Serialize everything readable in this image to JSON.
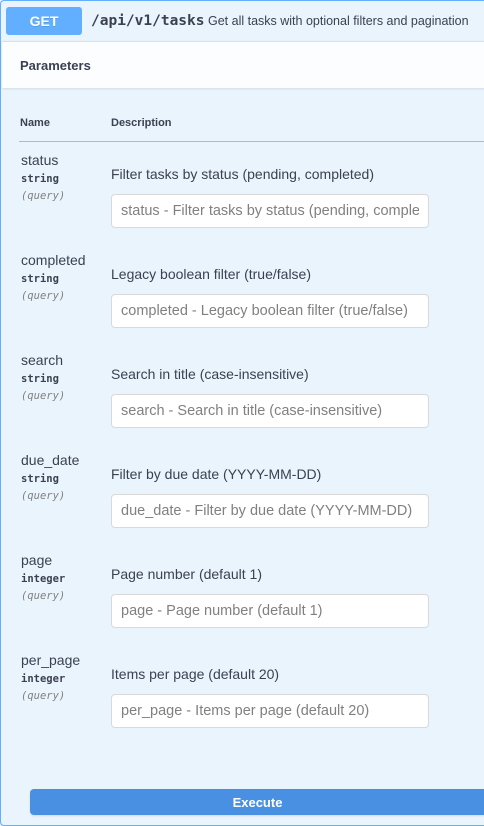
{
  "operation": {
    "method": "GET",
    "path": "/api/v1/tasks",
    "summary": "Get all tasks with optional filters and pagination"
  },
  "params_section": {
    "title": "Parameters",
    "col_name": "Name",
    "col_description": "Description"
  },
  "parameters": [
    {
      "name": "status",
      "type": "string",
      "in": "(query)",
      "description": "Filter tasks by status (pending, completed)",
      "placeholder": "status - Filter tasks by status (pending, completed)"
    },
    {
      "name": "completed",
      "type": "string",
      "in": "(query)",
      "description": "Legacy boolean filter (true/false)",
      "placeholder": "completed - Legacy boolean filter (true/false)"
    },
    {
      "name": "search",
      "type": "string",
      "in": "(query)",
      "description": "Search in title (case-insensitive)",
      "placeholder": "search - Search in title (case-insensitive)"
    },
    {
      "name": "due_date",
      "type": "string",
      "in": "(query)",
      "description": "Filter by due date (YYYY-MM-DD)",
      "placeholder": "due_date - Filter by due date (YYYY-MM-DD)"
    },
    {
      "name": "page",
      "type": "integer",
      "in": "(query)",
      "description": "Page number (default 1)",
      "placeholder": "page - Page number (default 1)"
    },
    {
      "name": "per_page",
      "type": "integer",
      "in": "(query)",
      "description": "Items per page (default 20)",
      "placeholder": "per_page - Items per page (default 20)"
    }
  ],
  "execute_label": "Execute",
  "colors": {
    "get_method": "#61affe",
    "execute_button": "#4990e2",
    "background": "#eaf4fd"
  }
}
